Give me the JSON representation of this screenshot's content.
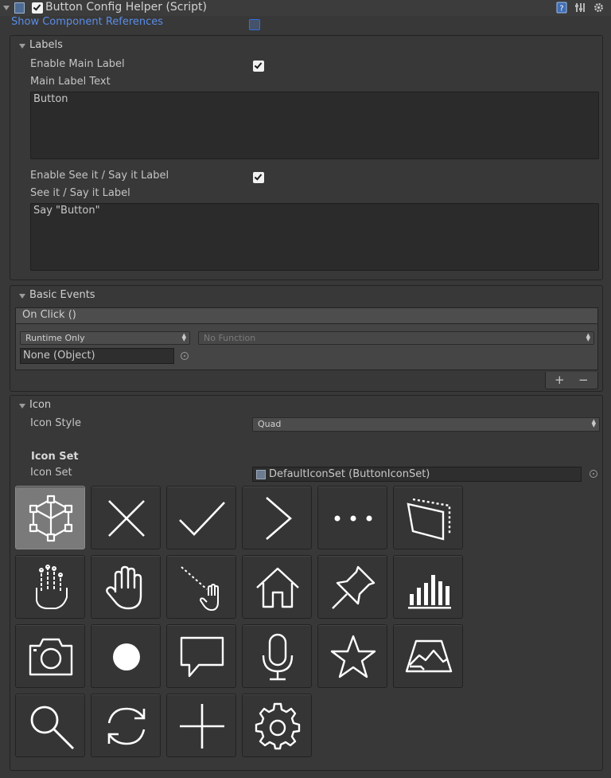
{
  "header": {
    "title": "Button Config Helper (Script)",
    "enabled": true,
    "icons": [
      "help-icon",
      "preset-icon",
      "settings-gear-icon"
    ]
  },
  "show_component_references": {
    "label": "Show Component References",
    "checked": false
  },
  "labels_group": {
    "title": "Labels",
    "enable_main_label": {
      "label": "Enable Main Label",
      "checked": true
    },
    "main_label_text": {
      "label": "Main Label Text",
      "value": "Button"
    },
    "enable_see_it_say_it": {
      "label": "Enable See it / Say it Label",
      "checked": true
    },
    "see_it_say_it_label": {
      "label": "See it / Say it Label",
      "value": "Say \"Button\""
    }
  },
  "basic_events": {
    "title": "Basic Events",
    "event_name": "On Click ()",
    "runtime_mode": "Runtime Only",
    "function": "No Function",
    "object": "None (Object)",
    "add_label": "+",
    "remove_label": "−"
  },
  "icon_group": {
    "title": "Icon",
    "icon_style": {
      "label": "Icon Style",
      "value": "Quad"
    },
    "icon_set_header": "Icon Set",
    "icon_set": {
      "label": "Icon Set",
      "value": "DefaultIconSet (ButtonIconSet)"
    },
    "selected_icon": "cube-select-icon",
    "icons": [
      "cube-select-icon",
      "close-x-icon",
      "checkmark-icon",
      "chevron-right-icon",
      "ellipsis-icon",
      "slate-icon",
      "hand-joints-icon",
      "hand-icon",
      "hand-ray-icon",
      "home-icon",
      "pin-icon",
      "bar-chart-icon",
      "camera-icon",
      "record-dot-icon",
      "speech-bubble-icon",
      "microphone-icon",
      "star-icon",
      "map-icon",
      "search-icon",
      "refresh-icon",
      "plus-icon",
      "gear-icon"
    ]
  },
  "colors": {
    "background": "#383838",
    "link": "#5a8de6",
    "selected_tile": "#7a7a7a"
  }
}
